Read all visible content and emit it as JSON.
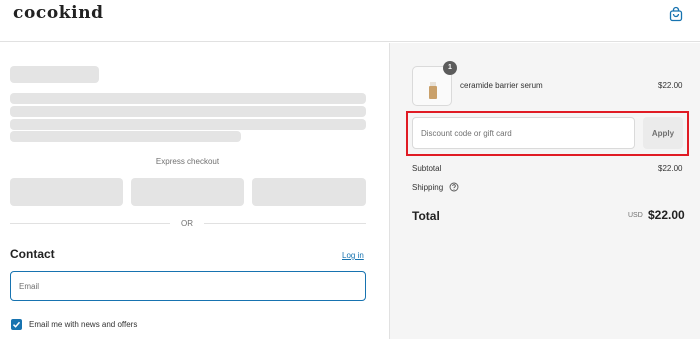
{
  "header": {
    "logo_text": "cocokind",
    "cart_icon": "shopping-bag-icon",
    "accent_color": "#1773b0"
  },
  "express_checkout": {
    "label": "Express checkout",
    "divider_text": "OR"
  },
  "contact": {
    "title": "Contact",
    "login_link": "Log in",
    "email_placeholder": "Email",
    "newsletter_checked": true,
    "newsletter_label": "Email me with news and offers"
  },
  "order_summary": {
    "item": {
      "name": "ceramide barrier serum",
      "price": "$22.00",
      "quantity": "1"
    },
    "discount": {
      "placeholder": "Discount code or gift card",
      "apply_label": "Apply",
      "highlight_color": "#e01b24"
    },
    "subtotal_label": "Subtotal",
    "subtotal_value": "$22.00",
    "shipping_label": "Shipping",
    "shipping_info_icon": "help-circle-icon",
    "total_label": "Total",
    "currency": "USD",
    "total_value": "$22.00"
  }
}
